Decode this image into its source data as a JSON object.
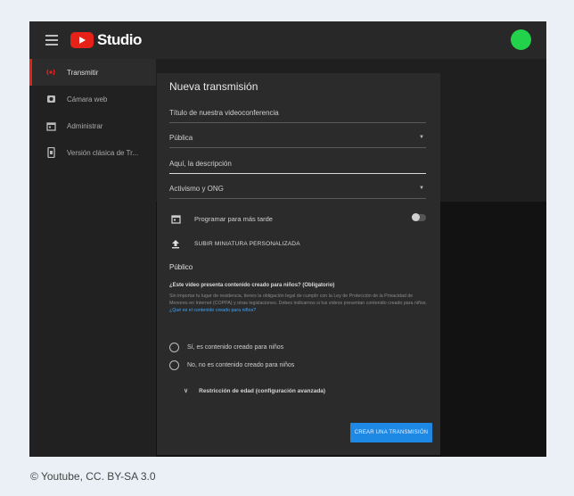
{
  "app": {
    "logo_text": "Studio",
    "brand_color": "#e62117",
    "avatar_color": "#23d24b"
  },
  "sidebar": {
    "items": [
      {
        "label": "Transmitir",
        "icon": "live-stream-icon",
        "active": true
      },
      {
        "label": "Cámara web",
        "icon": "webcam-icon",
        "active": false
      },
      {
        "label": "Administrar",
        "icon": "calendar-manage-icon",
        "active": false
      },
      {
        "label": "Versión clásica de Tr...",
        "icon": "mobile-classic-icon",
        "active": false
      }
    ]
  },
  "dialog": {
    "title": "Nueva transmisión",
    "title_field": {
      "value": "Título de nuestra videoconferencia"
    },
    "visibility": {
      "value": "Pública"
    },
    "description": {
      "value": "Aquí, la descripción"
    },
    "category": {
      "value": "Activismo y ONG"
    },
    "schedule_label": "Programar para más tarde",
    "upload_label": "SUBIR MINIATURA PERSONALIZADA",
    "audience": {
      "heading": "Público",
      "question": "¿Este video presenta contenido creado para niños? (Obligatorio)",
      "paragraph": "Sin importar tu lugar de residencia, tienes la obligación legal de cumplir con la Ley de Protección de la Privacidad de Menores en Internet (COPPA) y otras legislaciones. Debes indicarnos si tus videos presentan contenido creado para niños.",
      "link": "¿Qué es el contenido creado para niños?",
      "option_yes": "Sí, es contenido creado para niños",
      "option_no": "No, no es contenido creado para niños"
    },
    "age_restriction": "Restricción de edad (configuración avanzada)",
    "create_button": "CREAR UNA TRANSMISIÓN"
  },
  "caption": "© Youtube, CC. BY-SA 3.0"
}
